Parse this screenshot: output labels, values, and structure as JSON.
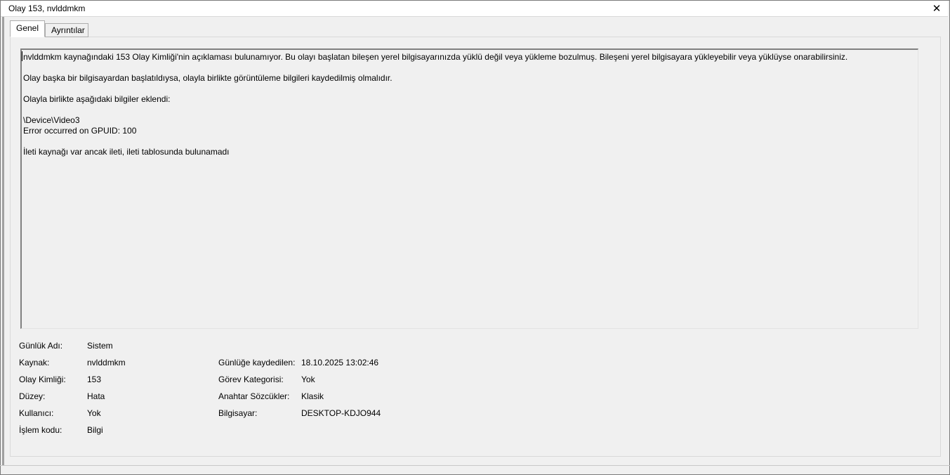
{
  "window": {
    "title": "Olay 153, nvlddmkm",
    "close_glyph": "✕"
  },
  "tabs": [
    {
      "label": "Genel",
      "active": true
    },
    {
      "label": "Ayrıntılar",
      "active": false
    }
  ],
  "description": {
    "lines": [
      "nvlddmkm kaynağındaki 153 Olay Kimliği'nin açıklaması bulunamıyor. Bu olayı başlatan bileşen yerel bilgisayarınızda yüklü değil veya yükleme bozulmuş. Bileşeni yerel bilgisayara yükleyebilir veya yüklüyse onarabilirsiniz.",
      "",
      "Olay başka bir bilgisayardan başlatıldıysa, olayla birlikte görüntüleme bilgileri kaydedilmiş olmalıdır.",
      "",
      "Olayla birlikte aşağıdaki bilgiler eklendi:",
      "",
      "\\Device\\Video3",
      "Error occurred on GPUID: 100",
      "",
      "İleti kaynağı var ancak ileti, ileti tablosunda bulunamadı"
    ]
  },
  "details": {
    "log_name_label": "Günlük Adı:",
    "log_name_value": "Sistem",
    "source_label": "Kaynak:",
    "source_value": "nvlddmkm",
    "logged_label": "Günlüğe kaydedilen:",
    "logged_value": "18.10.2025 13:02:46",
    "event_id_label": "Olay Kimliği:",
    "event_id_value": "153",
    "task_category_label": "Görev Kategorisi:",
    "task_category_value": "Yok",
    "level_label": "Düzey:",
    "level_value": "Hata",
    "keywords_label": "Anahtar Sözcükler:",
    "keywords_value": "Klasik",
    "user_label": "Kullanıcı:",
    "user_value": "Yok",
    "computer_label": "Bilgisayar:",
    "computer_value": "DESKTOP-KDJO944",
    "opcode_label": "İşlem kodu:",
    "opcode_value": "Bilgi"
  }
}
